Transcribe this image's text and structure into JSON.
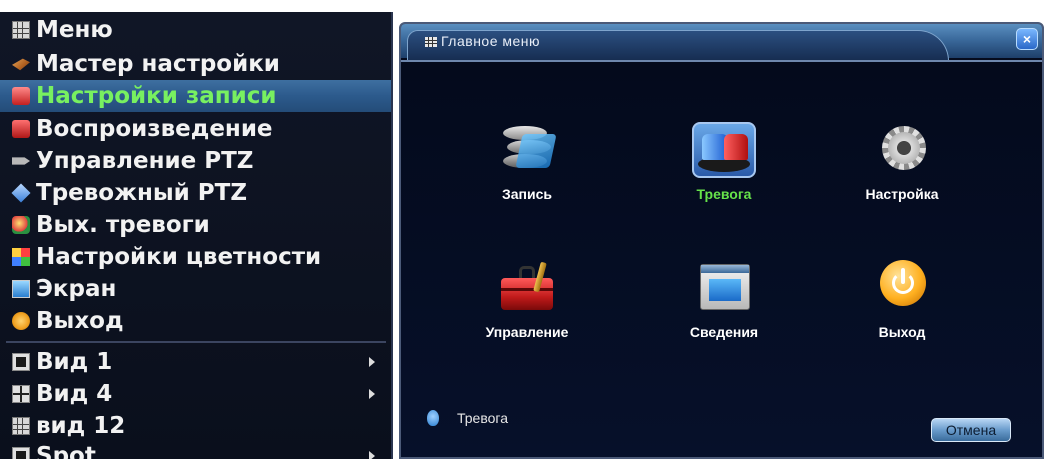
{
  "context_menu": {
    "items": [
      {
        "label": "Меню",
        "icon": "grid-icon"
      },
      {
        "label": "Мастер настройки",
        "icon": "wand-icon"
      },
      {
        "label": "Настройки записи",
        "icon": "record-icon",
        "selected": true
      },
      {
        "label": "Воспроизведение",
        "icon": "playback-icon"
      },
      {
        "label": "Управление PTZ",
        "icon": "ptz-icon"
      },
      {
        "label": "Тревожный PTZ",
        "icon": "diamond-icon"
      },
      {
        "label": "Вых. тревоги",
        "icon": "alarm-output-icon"
      },
      {
        "label": "Настройки цветности",
        "icon": "color-icon"
      },
      {
        "label": "Экран",
        "icon": "screen-icon"
      },
      {
        "label": "Выход",
        "icon": "exit-icon"
      },
      {
        "label": "Вид 1",
        "icon": "view1-icon",
        "submenu": true
      },
      {
        "label": "Вид 4",
        "icon": "view4-icon",
        "submenu": true
      },
      {
        "label": "вид 12",
        "icon": "view12-icon",
        "submenu": false
      },
      {
        "label": "Spot",
        "icon": "spot-icon",
        "submenu": true
      }
    ],
    "colors": {
      "background": "#0d1322",
      "selected_background": "#2f5d8e",
      "selected_text": "#78f060",
      "text": "#f2f2f2"
    }
  },
  "main_window": {
    "title": "Главное меню",
    "close_label": "×",
    "tiles": [
      {
        "label": "Запись",
        "icon": "record-reels-icon",
        "active": false
      },
      {
        "label": "Тревога",
        "icon": "alarm-lamp-icon",
        "active": true
      },
      {
        "label": "Настройка",
        "icon": "gear-icon",
        "active": false
      },
      {
        "label": "Управление",
        "icon": "toolbox-icon",
        "active": false
      },
      {
        "label": "Сведения",
        "icon": "info-window-icon",
        "active": false
      },
      {
        "label": "Выход",
        "icon": "power-icon",
        "active": false
      }
    ],
    "status_text": "Тревога",
    "cancel_label": "Отмена",
    "colors": {
      "background": "#050b1e",
      "active_label": "#66e24a",
      "title_bar": "#3b6a9c"
    }
  }
}
